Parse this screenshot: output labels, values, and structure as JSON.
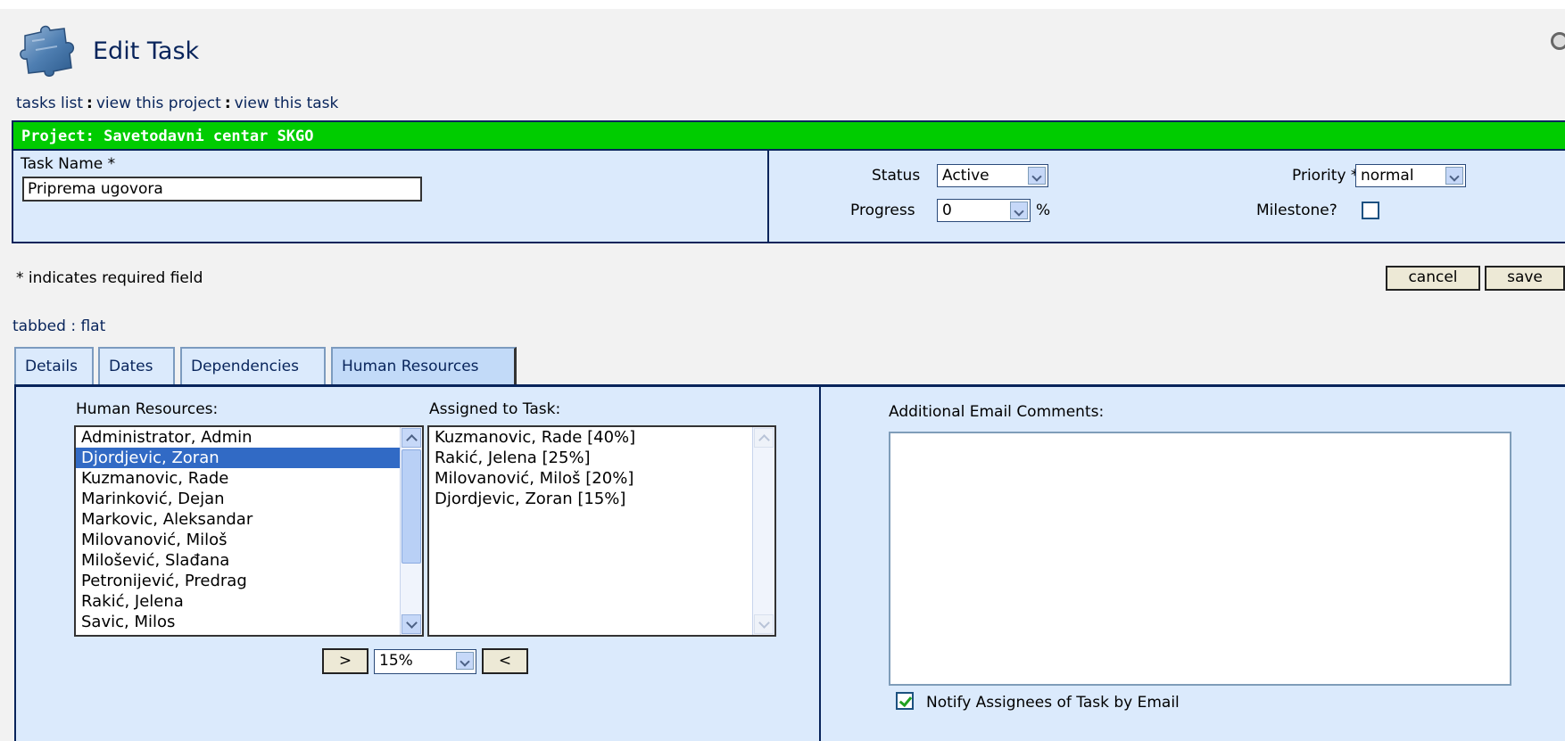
{
  "header": {
    "title": "Edit Task",
    "icon": "puzzle-icon",
    "corner_icon": "help-icon"
  },
  "breadcrumbs": [
    {
      "label": "tasks list"
    },
    {
      "label": "view this project"
    },
    {
      "label": "view this task"
    }
  ],
  "breadcrumb_separator": ":",
  "project": {
    "label": "Project: Savetodavni centar SKGO",
    "bar_color": "#00cc00"
  },
  "task_name": {
    "label": "Task Name *",
    "value": "Priprema ugovora"
  },
  "status": {
    "label": "Status",
    "value": "Active"
  },
  "progress": {
    "label": "Progress",
    "value": "0",
    "unit": "%"
  },
  "priority": {
    "label": "Priority *",
    "value": "normal"
  },
  "milestone": {
    "label": "Milestone?",
    "checked": false
  },
  "required_note": "* indicates required field",
  "buttons": {
    "cancel": "cancel",
    "save": "save"
  },
  "view_mode": {
    "tabbed": "tabbed",
    "separator": " : ",
    "flat": "flat"
  },
  "tabs": [
    {
      "label": "Details"
    },
    {
      "label": "Dates"
    },
    {
      "label": "Dependencies"
    },
    {
      "label": "Human Resources",
      "active": true
    }
  ],
  "human_resources": {
    "available_label": "Human Resources:",
    "assigned_label": "Assigned to Task:",
    "available": [
      "Administrator, Admin",
      "Djordjevic, Zoran",
      "Kuzmanovic, Rade",
      "Marinković, Dejan",
      "Markovic, Aleksandar",
      "Milovanović, Miloš",
      "Milošević, Slađana",
      "Petronijević, Predrag",
      "Rakić, Jelena",
      "Savic, Milos"
    ],
    "selected_index": 1,
    "assigned": [
      "Kuzmanovic, Rade [40%]",
      "Rakić, Jelena [25%]",
      "Milovanović, Miloš [20%]",
      "Djordjevic, Zoran [15%]"
    ],
    "add_button": ">",
    "remove_button": "<",
    "percent_value": "15%"
  },
  "email": {
    "comments_label": "Additional Email Comments:",
    "comments_value": "",
    "notify_label": "Notify Assignees of Task by Email",
    "notify_checked": true
  },
  "colors": {
    "accent_navy": "#08245b",
    "panel_bg": "#dbeafc",
    "selection": "#316ac5"
  }
}
